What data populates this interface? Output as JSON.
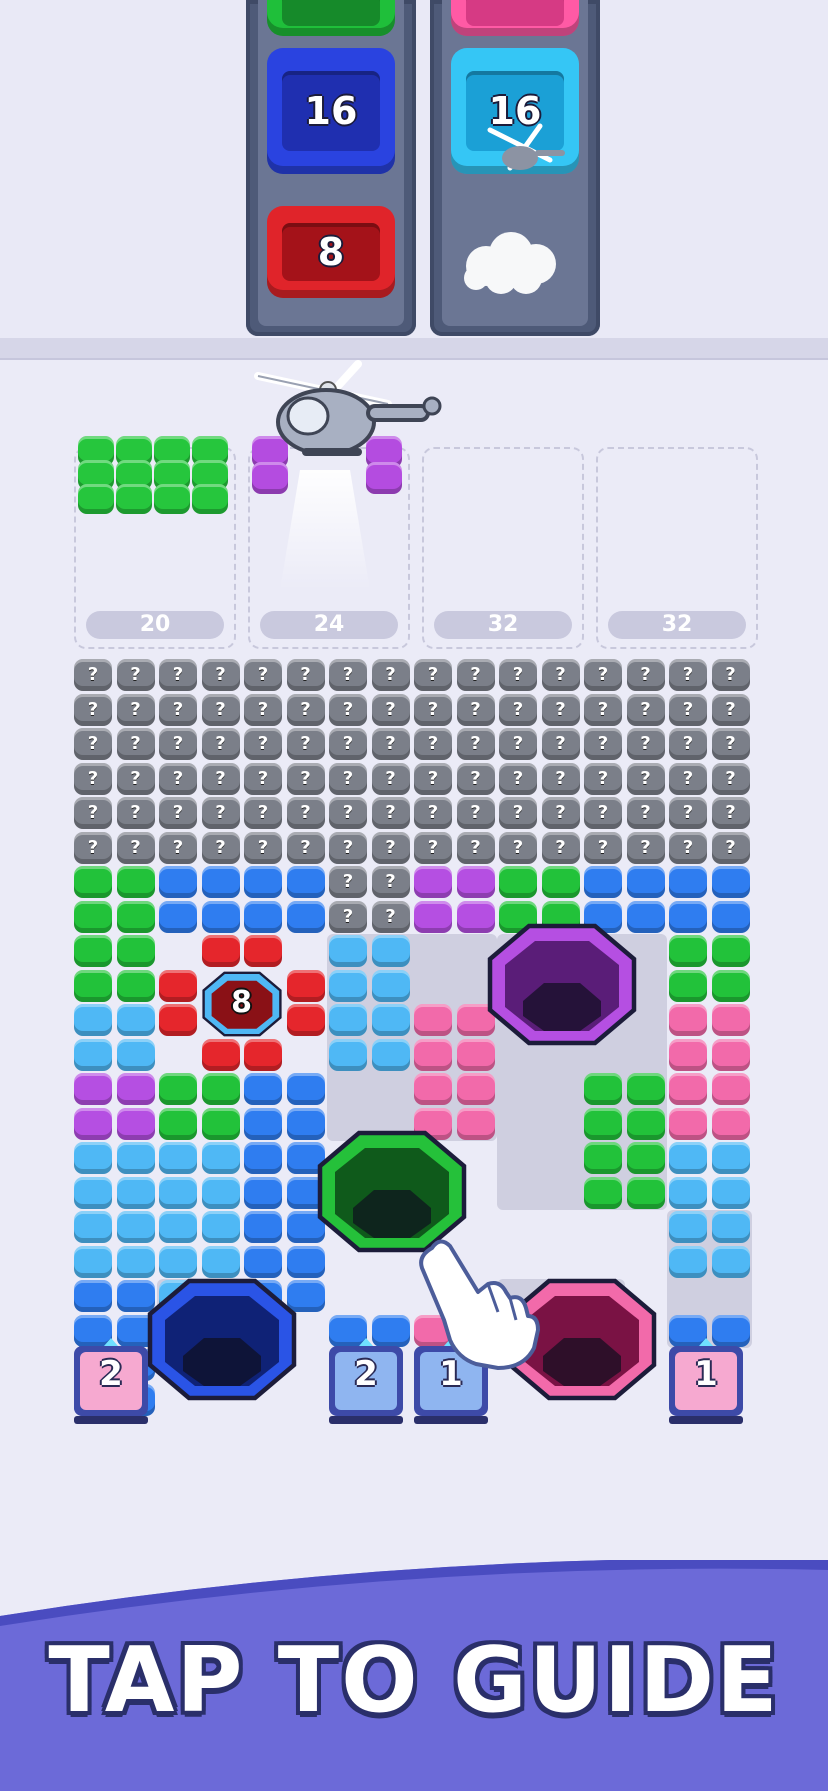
{
  "lanes": [
    {
      "containers": [
        {
          "number": "",
          "color": "#1fbf3a",
          "inner": "#168a2a"
        },
        {
          "number": "16",
          "color": "#2a43e0",
          "inner": "#1f2fb0"
        },
        {
          "number": "8",
          "color": "#e0242a",
          "inner": "#a41219"
        }
      ]
    },
    {
      "containers": [
        {
          "number": "",
          "color": "#ff5aa5",
          "inner": "#d63a84"
        },
        {
          "number": "16",
          "color": "#35c6f5",
          "inner": "#1ba0d6"
        }
      ]
    }
  ],
  "slots": [
    {
      "label": "20",
      "color": "#26c63d"
    },
    {
      "label": "24",
      "color": "#b44ce0"
    },
    {
      "label": "32",
      "color": ""
    },
    {
      "label": "32",
      "color": ""
    }
  ],
  "grid": {
    "question_mark": "?",
    "center_hole_number": "8"
  },
  "stacks": [
    {
      "number": "2",
      "color": "#f6a9d0"
    },
    {
      "number": "2",
      "color": "#8fb5f0"
    },
    {
      "number": "1",
      "color": "#8fb5f0"
    },
    {
      "number": "1",
      "color": "#f6a9d0"
    }
  ],
  "colors": {
    "green": "#22c23a",
    "blue": "#2f7df0",
    "light_blue": "#4fb8f5",
    "purple": "#b54fe2",
    "pink": "#f26aaa",
    "red": "#e5262c",
    "gray": "#7b7f89"
  },
  "banner": {
    "text": "TAP TO GUIDE"
  }
}
